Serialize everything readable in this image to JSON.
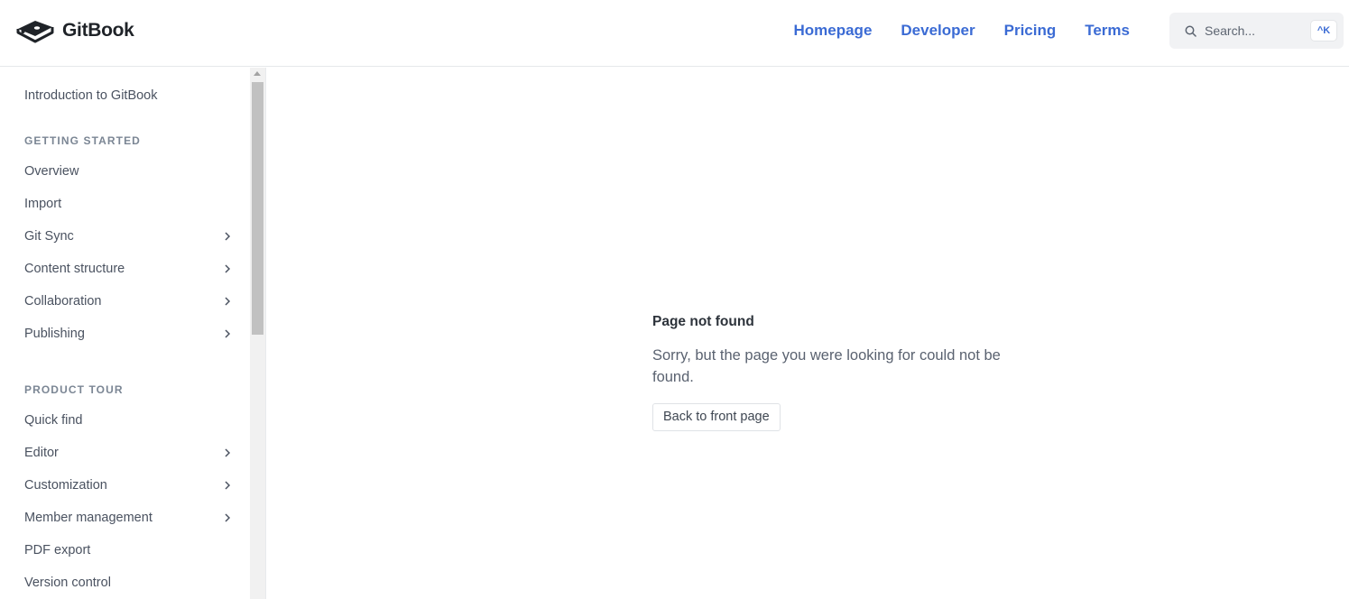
{
  "header": {
    "logo_text": "GitBook",
    "nav": [
      "Homepage",
      "Developer",
      "Pricing",
      "Terms"
    ],
    "search_placeholder": "Search...",
    "search_shortcut": "^K"
  },
  "sidebar": {
    "intro": "Introduction to GitBook",
    "sections": [
      {
        "title": "GETTING STARTED",
        "items": [
          {
            "label": "Overview",
            "expandable": false
          },
          {
            "label": "Import",
            "expandable": false
          },
          {
            "label": "Git Sync",
            "expandable": true
          },
          {
            "label": "Content structure",
            "expandable": true
          },
          {
            "label": "Collaboration",
            "expandable": true
          },
          {
            "label": "Publishing",
            "expandable": true
          }
        ]
      },
      {
        "title": "PRODUCT TOUR",
        "items": [
          {
            "label": "Quick find",
            "expandable": false
          },
          {
            "label": "Editor",
            "expandable": true
          },
          {
            "label": "Customization",
            "expandable": true
          },
          {
            "label": "Member management",
            "expandable": true
          },
          {
            "label": "PDF export",
            "expandable": false
          },
          {
            "label": "Version control",
            "expandable": false
          }
        ]
      }
    ]
  },
  "main": {
    "title": "Page not found",
    "message": "Sorry, but the page you were looking for could not be found.",
    "button": "Back to front page"
  },
  "colors": {
    "nav_link": "#3b6bd4",
    "section_title": "#7b8694"
  }
}
